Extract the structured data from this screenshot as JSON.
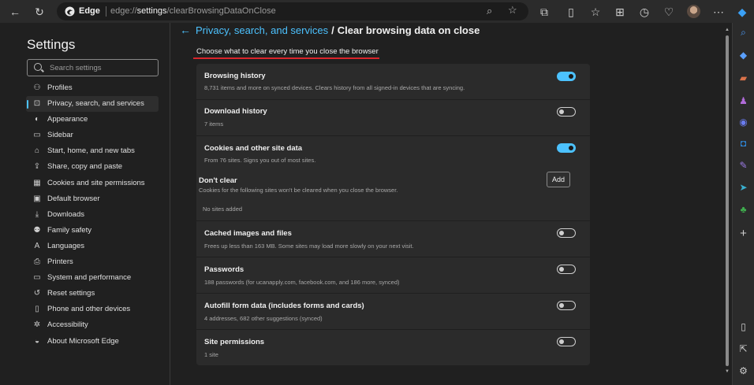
{
  "browser": {
    "brand": "Edge",
    "url_prefix": "edge://",
    "url_host": "settings",
    "url_path": "/clearBrowsingDataOnClose"
  },
  "nav": {
    "title": "Settings",
    "search_placeholder": "Search settings",
    "items": [
      {
        "label": "Profiles",
        "icon": "profile-icon"
      },
      {
        "label": "Privacy, search, and services",
        "icon": "lock-icon"
      },
      {
        "label": "Appearance",
        "icon": "appearance-icon"
      },
      {
        "label": "Sidebar",
        "icon": "sidebar-icon"
      },
      {
        "label": "Start, home, and new tabs",
        "icon": "home-icon"
      },
      {
        "label": "Share, copy and paste",
        "icon": "share-icon"
      },
      {
        "label": "Cookies and site permissions",
        "icon": "cookies-icon"
      },
      {
        "label": "Default browser",
        "icon": "browser-icon"
      },
      {
        "label": "Downloads",
        "icon": "download-icon"
      },
      {
        "label": "Family safety",
        "icon": "family-icon"
      },
      {
        "label": "Languages",
        "icon": "language-icon"
      },
      {
        "label": "Printers",
        "icon": "printer-icon"
      },
      {
        "label": "System and performance",
        "icon": "system-icon"
      },
      {
        "label": "Reset settings",
        "icon": "reset-icon"
      },
      {
        "label": "Phone and other devices",
        "icon": "phone-icon"
      },
      {
        "label": "Accessibility",
        "icon": "accessibility-icon"
      },
      {
        "label": "About Microsoft Edge",
        "icon": "edge-icon"
      }
    ]
  },
  "page": {
    "breadcrumb_link": "Privacy, search, and services",
    "breadcrumb_sep": "/",
    "title": "Clear browsing data on close",
    "subtitle": "Choose what to clear every time you close the browser"
  },
  "rows": {
    "browsing_history": {
      "title": "Browsing history",
      "desc": "8,731 items and more on synced devices. Clears history from all signed-in devices that are syncing.",
      "on": true
    },
    "download_history": {
      "title": "Download history",
      "desc": "7 items",
      "on": false
    },
    "cookies": {
      "title": "Cookies and other site data",
      "desc": "From 76 sites. Signs you out of most sites.",
      "on": true
    },
    "dont_clear": {
      "title": "Don't clear",
      "desc": "Cookies for the following sites won't be cleared when you close the browser.",
      "add_label": "Add",
      "empty": "No sites added"
    },
    "cached": {
      "title": "Cached images and files",
      "desc": "Frees up less than 163 MB. Some sites may load more slowly on your next visit.",
      "on": false
    },
    "passwords": {
      "title": "Passwords",
      "desc": "188 passwords (for ucanapply.com, facebook.com, and 186 more, synced)",
      "on": false
    },
    "autofill": {
      "title": "Autofill form data (includes forms and cards)",
      "desc": "4 addresses, 682 other suggestions (synced)",
      "on": false
    },
    "site_permissions": {
      "title": "Site permissions",
      "desc": "1 site",
      "on": false
    }
  },
  "colors": {
    "accent": "#4cc2ff",
    "underline": "#d9252b"
  }
}
